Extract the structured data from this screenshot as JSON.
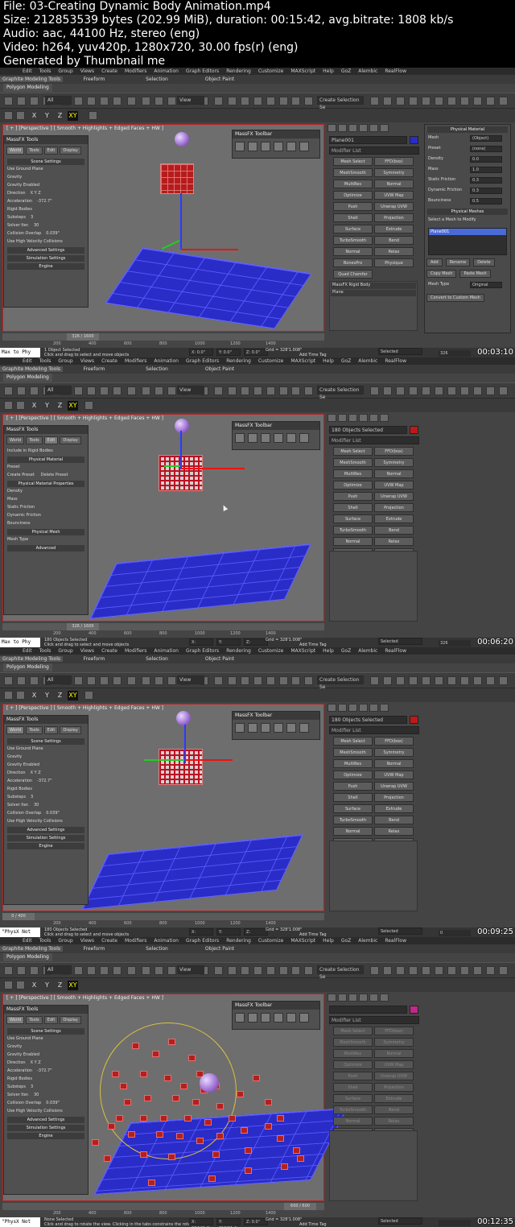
{
  "header": {
    "file": "File: 03-Creating Dynamic Body Animation.mp4",
    "size": "Size: 212853539 bytes (202.99 MiB), duration: 00:15:42, avg.bitrate: 1808 kb/s",
    "audio": "Audio: aac, 44100 Hz, stereo (eng)",
    "video": "Video: h264, yuv420p, 1280x720, 30.00 fps(r) (eng)",
    "generated": "Generated by Thumbnail me"
  },
  "menu": [
    "Edit",
    "Tools",
    "Group",
    "Views",
    "Create",
    "Modifiers",
    "Animation",
    "Graph Editors",
    "Rendering",
    "Customize",
    "MAXScript",
    "Help",
    "GoZ",
    "Alembic",
    "RealFlow"
  ],
  "ribbon": {
    "tabs": [
      "Graphite Modeling Tools",
      "Freeform",
      "Selection",
      "Object Paint"
    ],
    "subtab": "Polygon Modeling"
  },
  "toolbar": {
    "filter": "All",
    "refcoord": "View",
    "selset": "Create Selection Se",
    "axes": [
      "X",
      "Y",
      "Z",
      "XY"
    ]
  },
  "viewport_label": "[ + ] [Perspective ] [ Smooth + Highlights + Edged Faces + HW ]",
  "massfx_toolbar_title": "MassFX Toolbar",
  "massfx_tools": {
    "title": "MassFX Tools",
    "tabs": [
      "World",
      "Tools",
      "Edit",
      "Display"
    ],
    "scene_settings": "Scene Settings",
    "use_ground_plane": "Use Ground Plane",
    "gravity": "Gravity",
    "gravity_enabled": "Gravity Enabled",
    "direction": "Direction",
    "direction_axes": "X   Y   Z",
    "acceleration": "Acceleration",
    "acceleration_value": "-372.7\"",
    "rigid_bodies": "Rigid Bodies",
    "substeps": "Substeps",
    "substeps_value": "3",
    "solver_iter": "Solver Iter.",
    "solver_iter_value": "30",
    "collision_overlap": "Collision Overlap",
    "collision_overlap_value": "0.039\"",
    "use_high_velocity": "Use High Velocity Collisions",
    "advanced_settings": "Advanced Settings",
    "simulation_settings": "Simulation Settings",
    "engine": "Engine"
  },
  "massfx_edit": {
    "include_rigid": "Include in Rigid Bodies",
    "physical_material": "Physical Material",
    "preset": "Preset",
    "create_preset": "Create Preset",
    "delete_preset": "Delete Preset",
    "phys_mat_props": "Physical Material Properties",
    "density": "Density",
    "mass": "Mass",
    "static_friction": "Static Friction",
    "dynamic_friction": "Dynamic Friction",
    "bounciness": "Bounciness",
    "physical_mesh": "Physical Mesh",
    "mesh_type": "Mesh Type",
    "advanced": "Advanced"
  },
  "modifier_list_label": "Modifier List",
  "modifier_buttons": [
    "Mesh Select",
    "FFD(box)",
    "MeshSmooth",
    "Symmetry",
    "MultiRes",
    "Normal",
    "Optimize",
    "UVW Map",
    "Push",
    "Unwrap UVW",
    "Shell",
    "Projection",
    "Surface",
    "Extrude",
    "TurboSmooth",
    "Bend",
    "Normal",
    "Relax",
    "BonesPro",
    "Physique",
    "Quad Chamfer"
  ],
  "frames": [
    {
      "object_name": "Plane001",
      "object_color": "#2a2cc8",
      "stack": [
        "MassFX Rigid Body",
        "Plane"
      ],
      "time": "326 / 1600",
      "status_left": "Max to Phy",
      "selected": "1 Object Selected",
      "prompt": "Click and drag to select and move objects",
      "coords": [
        "X: 0.0\"",
        "Y: 0.0\"",
        "Z: 0.0\""
      ],
      "grid": "Grid = 328'1.008\"",
      "add_time_tag": "Add Time Tag",
      "key_mode": "Selected",
      "frame_no": "326",
      "timestamp": "00:03:10"
    },
    {
      "object_name": "180 Objects Selected",
      "object_color": "#c01818",
      "stack": [],
      "time": "326 / 1600",
      "status_left": "Max to Phy",
      "selected": "180 Objects Selected",
      "prompt": "Click and drag to select and move objects",
      "coords": [
        "X:",
        "Y:",
        "Z:"
      ],
      "grid": "Grid = 328'1.008\"",
      "add_time_tag": "Add Time Tag",
      "key_mode": "Selected",
      "frame_no": "326",
      "timestamp": "00:06:20"
    },
    {
      "object_name": "180 Objects Selected",
      "object_color": "#c01818",
      "stack": [],
      "time": "0 / 400",
      "status_left": "\"PhysX Not",
      "selected": "180 Objects Selected",
      "prompt": "Click and drag to select and move objects",
      "coords": [
        "X:",
        "Y:",
        "Z:"
      ],
      "grid": "Grid = 328'1.008\"",
      "add_time_tag": "Add Time Tag",
      "key_mode": "Selected",
      "frame_no": "0",
      "timestamp": "00:09:25"
    },
    {
      "object_name": "",
      "object_color": "#c0288a",
      "stack": [],
      "time": "600 / 600",
      "status_left": "\"PhysX Not",
      "selected": "None Selected",
      "prompt": "Click and drag to rotate the view.  Clicking in the tabs constrains the rotation",
      "coords": [
        "X: 264'41.3",
        "Y: 319'01.4",
        "Z: 0.0\""
      ],
      "grid": "Grid = 328'1.008\"",
      "add_time_tag": "Add Time Tag",
      "key_mode": "Selected",
      "frame_no": "",
      "timestamp": "00:12:35"
    }
  ],
  "physical_panel": {
    "title": "Physical Material",
    "mesh_label": "Mesh",
    "mesh_value": "(Object)",
    "preset_label": "Preset",
    "preset_value": "(none)",
    "density": "Density",
    "density_value": "0.0",
    "mass": "Mass",
    "mass_value": "1.0",
    "static_friction": "Static Friction",
    "static_value": "0.3",
    "dynamic_friction": "Dynamic Friction",
    "dynamic_value": "0.3",
    "bounciness": "Bounciness",
    "bounciness_value": "0.5",
    "physical_meshes": "Physical Meshes",
    "select_mesh": "Select a Mesh to Modify",
    "mesh_item": "Plane001",
    "add": "Add",
    "rename": "Rename",
    "delete": "Delete",
    "copy_mesh": "Copy Mesh",
    "paste_mesh": "Paste Mesh",
    "mesh_type_label": "Mesh Type",
    "mesh_type_value": "Original",
    "convert": "Convert to Custom Mesh"
  },
  "ruler_ticks": [
    "200",
    "400",
    "600",
    "800",
    "1000",
    "1200",
    "1400"
  ],
  "colors": {
    "selected_time": "#ff0",
    "floor": "#2a2cc8",
    "cubes": "#b51c1c",
    "sphere": "#9a6ad0"
  }
}
